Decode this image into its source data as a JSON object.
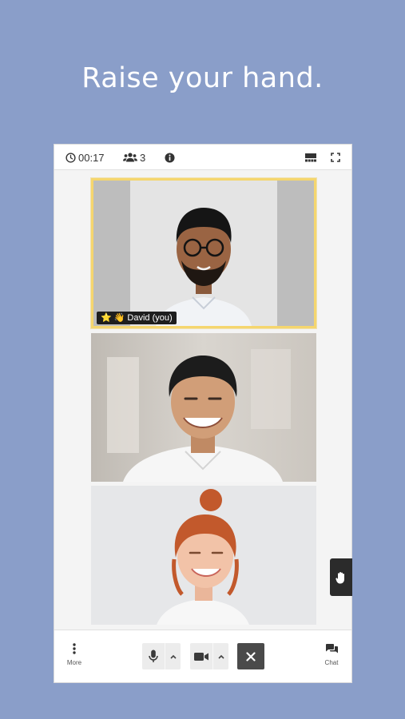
{
  "headline": "Raise your hand.",
  "topbar": {
    "timer": "00:17",
    "participants": "3"
  },
  "participants": [
    {
      "name": "David (you)",
      "raised_hand": true,
      "starred": true
    },
    {
      "name": ""
    },
    {
      "name": ""
    }
  ],
  "bottombar": {
    "more_label": "More",
    "chat_label": "Chat"
  },
  "colors": {
    "background": "#8a9ec9",
    "highlight": "#f5d66e"
  }
}
